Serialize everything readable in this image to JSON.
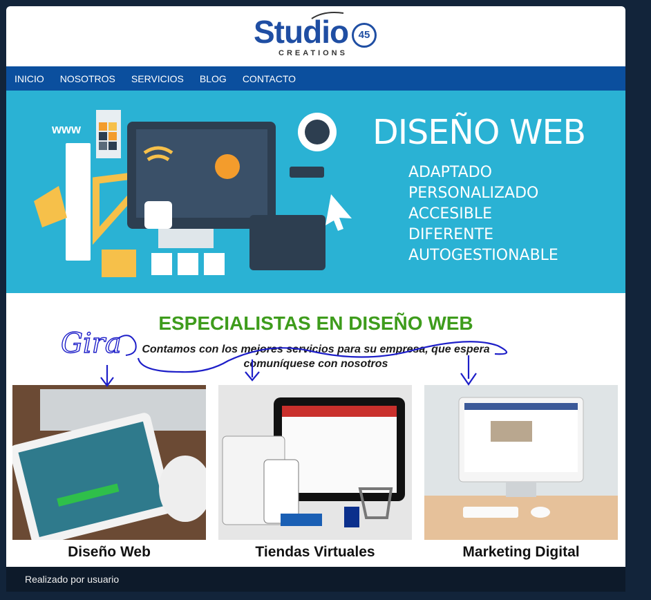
{
  "logo": {
    "main": "Studio",
    "number": "45",
    "subtitle": "CREATIONS"
  },
  "nav": [
    {
      "label": "INICIO"
    },
    {
      "label": "NOSOTROS"
    },
    {
      "label": "SERVICIOS"
    },
    {
      "label": "BLOG"
    },
    {
      "label": "CONTACTO"
    }
  ],
  "hero": {
    "title": "DISEÑO WEB",
    "features": [
      "ADAPTADO",
      "PERSONALIZADO",
      "ACCESIBLE",
      "DIFERENTE",
      "AUTOGESTIONABLE"
    ],
    "badge": "www"
  },
  "intro": {
    "headline": "ESPECIALISTAS EN DISEÑO WEB",
    "line1": "Contamos con los mejores servicios para su empresa, que espera",
    "line2": "comuníquese con nosotros"
  },
  "cards": [
    {
      "caption": "Diseño Web"
    },
    {
      "caption": "Tiendas Virtuales"
    },
    {
      "caption": "Marketing Digital"
    }
  ],
  "annotation": {
    "handwriting": "Gira"
  },
  "footer": {
    "text": "Realizado por usuario"
  },
  "colors": {
    "nav": "#0b4f9e",
    "hero": "#2ab2d4",
    "headline": "#3e9c1c",
    "footer": "#0d1a2a",
    "brand": "#1f4ea3"
  }
}
